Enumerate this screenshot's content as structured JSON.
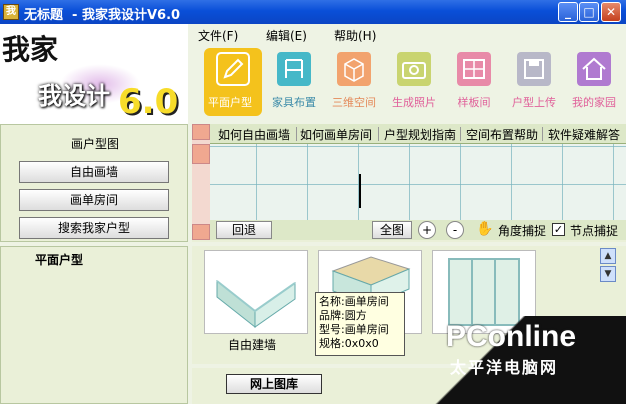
{
  "window": {
    "title": "无标题  - 我家我设计V6.0",
    "icon_text": "我"
  },
  "logo": {
    "brand": "我家",
    "sub": "我设计",
    "version": "6.0"
  },
  "menu": [
    "文件(F)",
    "编辑(E)",
    "帮助(H)"
  ],
  "toolbar": [
    {
      "label": "平面户型",
      "icon": "pencil-icon",
      "color": "#f4c21c",
      "active": true
    },
    {
      "label": "家具布置",
      "icon": "chair-icon",
      "color": "#46b8c8"
    },
    {
      "label": "三维空间",
      "icon": "cube-icon",
      "color": "#f2a36e"
    },
    {
      "label": "生成照片",
      "icon": "camera-icon",
      "color": "#c9d470"
    },
    {
      "label": "样板间",
      "icon": "room-icon",
      "color": "#e88aa8"
    },
    {
      "label": "户型上传",
      "icon": "disk-icon",
      "color": "#b8b8c8"
    },
    {
      "label": "我的家园",
      "icon": "house-icon",
      "color": "#b07ad0"
    }
  ],
  "left_panel": {
    "title": "画户型图",
    "buttons": [
      "自由画墙",
      "画单房间",
      "搜索我家户型"
    ],
    "section_title": "平面户型"
  },
  "help_tabs": [
    "如何自由画墙",
    "如何画单房间",
    "户型规划指南",
    "空间布置帮助",
    "软件疑难解答"
  ],
  "canvas_bar": {
    "back": "回退",
    "fit": "全图",
    "zoom_in": "+",
    "zoom_out": "-",
    "angle_snap": "角度捕捉",
    "node_snap": "节点捕捉"
  },
  "gallery": {
    "items": [
      {
        "label": "自由建墙"
      },
      {
        "label": ""
      },
      {
        "label": ""
      }
    ],
    "tooltip": {
      "name": "名称:画单房间",
      "brand": "品牌:圆方",
      "model": "型号:画单房间",
      "spec": "规格:0x0x0"
    },
    "online_button": "网上图库"
  },
  "watermark": {
    "brand": "PConline",
    "cn": "太平洋电脑网"
  }
}
